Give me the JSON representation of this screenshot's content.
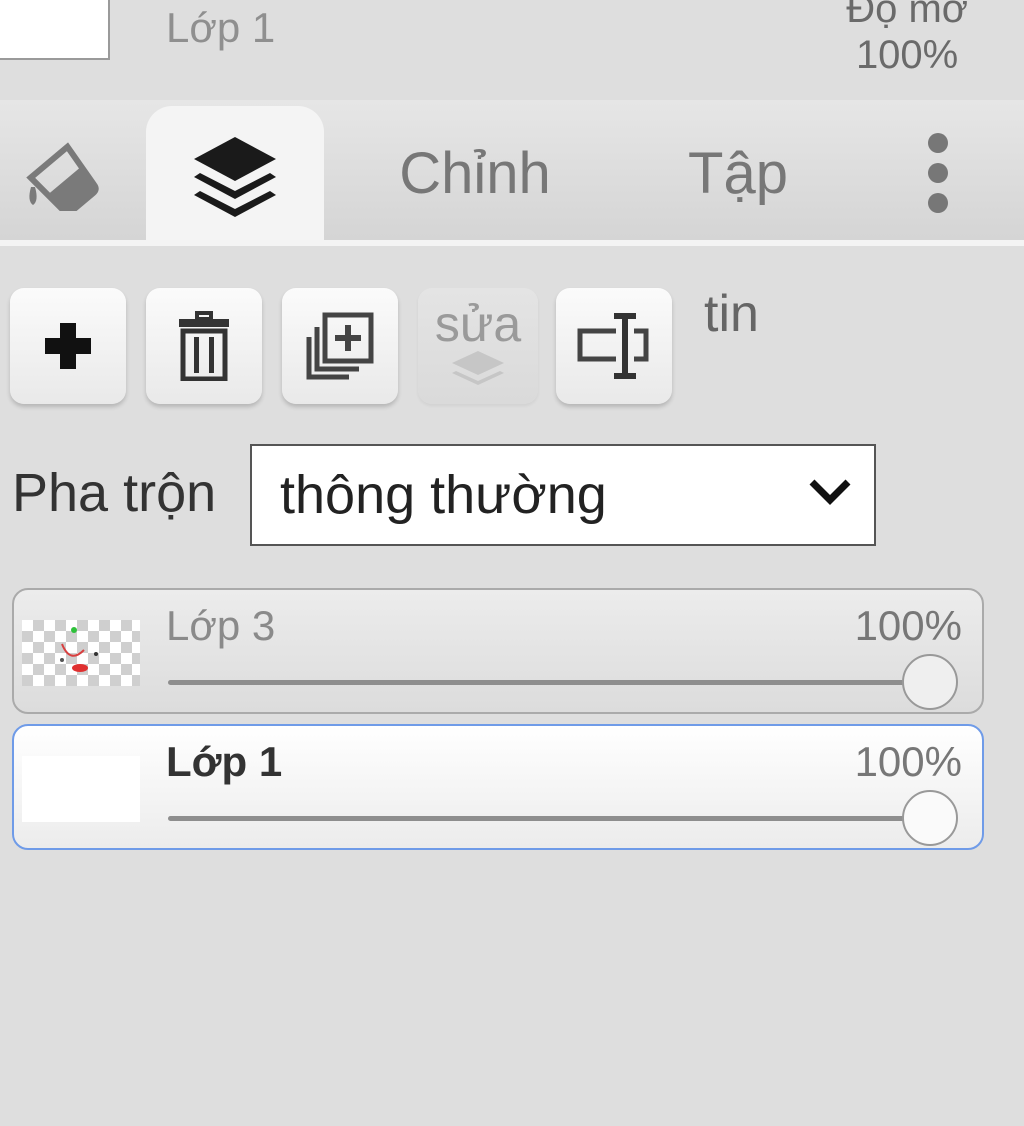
{
  "top": {
    "layer_name": "Lớp 1",
    "opacity_label": "Độ mờ",
    "opacity_value": "100%"
  },
  "tabs": {
    "fill_icon": "paint-bucket-icon",
    "layers_icon": "layers-icon",
    "adjust_label": "Chỉnh",
    "set_label": "Tập",
    "more_icon": "more-vertical-icon",
    "active": "layers"
  },
  "toolbar": {
    "add_icon": "plus-icon",
    "delete_icon": "trash-icon",
    "duplicate_icon": "duplicate-icon",
    "edit_label": "sửa",
    "rename_icon": "rename-icon",
    "info_label": "tin"
  },
  "blend": {
    "label": "Pha trộn",
    "value": "thông thường"
  },
  "layers": [
    {
      "name": "Lớp 3",
      "opacity_text": "100%",
      "opacity": 1.0,
      "selected": false,
      "thumbnail": "transparent-checker"
    },
    {
      "name": "Lớp 1",
      "opacity_text": "100%",
      "opacity": 1.0,
      "selected": true,
      "thumbnail": "white"
    }
  ],
  "colors": {
    "panel_bg": "#dedede",
    "active_tab_bg": "#f4f4f4",
    "selected_border": "#6f9be8"
  }
}
